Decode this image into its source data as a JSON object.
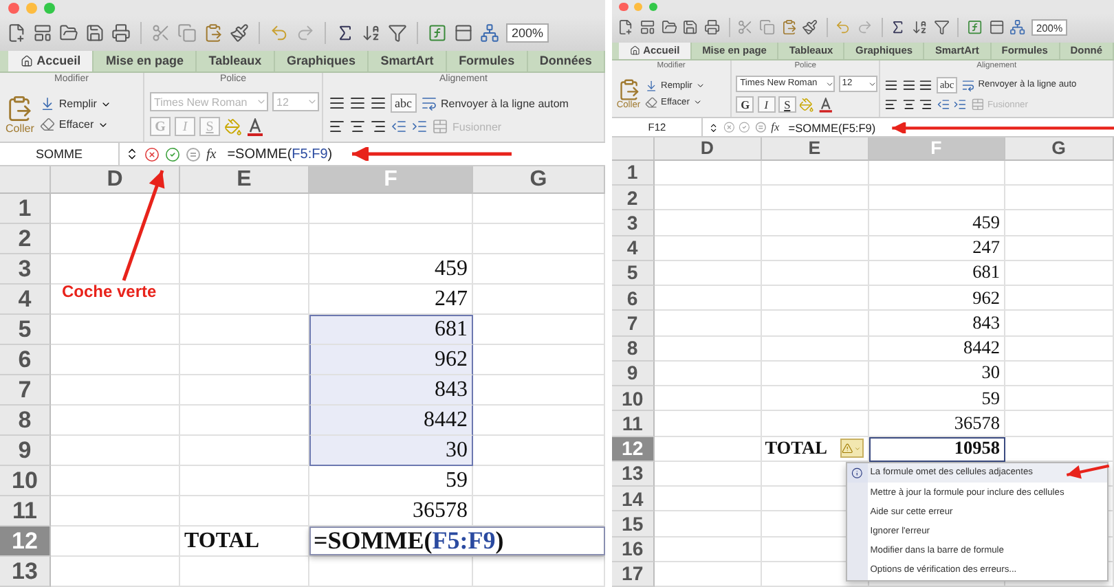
{
  "panels": [
    {
      "kind": "editing",
      "toolbar": {
        "zoom": "200%"
      },
      "tabs": [
        {
          "label": "Accueil",
          "selected": true
        },
        {
          "label": "Mise en page",
          "selected": false
        },
        {
          "label": "Tableaux",
          "selected": false
        },
        {
          "label": "Graphiques",
          "selected": false
        },
        {
          "label": "SmartArt",
          "selected": false
        },
        {
          "label": "Formules",
          "selected": false
        },
        {
          "label": "Données",
          "selected": false
        }
      ],
      "groups": [
        "Modifier",
        "Police",
        "Alignement"
      ],
      "edit": {
        "paste": "Coller",
        "fill": "Remplir",
        "clear": "Effacer"
      },
      "font": {
        "name": "Times New Roman",
        "size": "12",
        "disabled": true,
        "bold": "G",
        "italic": "I",
        "strike": "S"
      },
      "alignment": {
        "wrap_format": "abc",
        "wrap": "Renvoyer à la ligne autom",
        "merge": "Fusionner"
      },
      "formula_bar": {
        "name_box": "SOMME",
        "editing": true,
        "fx": "fx",
        "formula": [
          {
            "text": "=SOMME(",
            "ref": false
          },
          {
            "text": "F5:F9",
            "ref": true
          },
          {
            "text": ")",
            "ref": false
          }
        ]
      },
      "annotation": {
        "text": "Coche verte"
      },
      "sheet": {
        "columns": [
          {
            "label": "D",
            "selected": false
          },
          {
            "label": "E",
            "selected": false
          },
          {
            "label": "F",
            "selected": true
          },
          {
            "label": "G",
            "selected": false
          }
        ],
        "rows": [
          {
            "number": "1",
            "selected": false,
            "in_range": false
          },
          {
            "number": "2",
            "selected": false,
            "in_range": false
          },
          {
            "number": "3",
            "selected": false,
            "in_range": false,
            "value": "459"
          },
          {
            "number": "4",
            "selected": false,
            "in_range": false,
            "value": "247"
          },
          {
            "number": "5",
            "selected": false,
            "in_range": true,
            "value": "681"
          },
          {
            "number": "6",
            "selected": false,
            "in_range": true,
            "value": "962"
          },
          {
            "number": "7",
            "selected": false,
            "in_range": true,
            "value": "843"
          },
          {
            "number": "8",
            "selected": false,
            "in_range": true,
            "value": "8442"
          },
          {
            "number": "9",
            "selected": false,
            "in_range": true,
            "value": "30"
          },
          {
            "number": "10",
            "selected": false,
            "in_range": false,
            "value": "59"
          },
          {
            "number": "11",
            "selected": false,
            "in_range": false,
            "value": "36578"
          },
          {
            "number": "12",
            "selected": true,
            "in_range": false,
            "label": "TOTAL",
            "formula": [
              {
                "text": "=SOMME(",
                "ref": false
              },
              {
                "text": "F5:F9",
                "ref": true
              },
              {
                "text": ")",
                "ref": false
              }
            ]
          },
          {
            "number": "13",
            "selected": false,
            "in_range": false
          }
        ]
      }
    },
    {
      "kind": "error",
      "toolbar": {
        "zoom": "200%"
      },
      "tabs": [
        {
          "label": "Accueil",
          "selected": true
        },
        {
          "label": "Mise en page",
          "selected": false
        },
        {
          "label": "Tableaux",
          "selected": false
        },
        {
          "label": "Graphiques",
          "selected": false
        },
        {
          "label": "SmartArt",
          "selected": false
        },
        {
          "label": "Formules",
          "selected": false
        },
        {
          "label": "Donné",
          "selected": false
        }
      ],
      "groups": [
        "Modifier",
        "Police",
        "Alignement"
      ],
      "edit": {
        "paste": "Coller",
        "fill": "Remplir",
        "clear": "Effacer"
      },
      "font": {
        "name": "Times New Roman",
        "size": "12",
        "disabled": false,
        "bold": "G",
        "italic": "I",
        "strike": "S"
      },
      "alignment": {
        "wrap_format": "abc",
        "wrap": "Renvoyer à la ligne auto",
        "merge": "Fusionner"
      },
      "formula_bar": {
        "name_box": "F12",
        "editing": false,
        "fx": "fx",
        "formula": [
          {
            "text": "=SOMME(F5:F9)",
            "ref": false
          }
        ]
      },
      "sheet": {
        "columns": [
          {
            "label": "D",
            "selected": false
          },
          {
            "label": "E",
            "selected": false
          },
          {
            "label": "F",
            "selected": true
          },
          {
            "label": "G",
            "selected": false
          }
        ],
        "rows": [
          {
            "number": "1",
            "selected": false,
            "in_range": false
          },
          {
            "number": "2",
            "selected": false,
            "in_range": false
          },
          {
            "number": "3",
            "selected": false,
            "in_range": false,
            "value": "459"
          },
          {
            "number": "4",
            "selected": false,
            "in_range": false,
            "value": "247"
          },
          {
            "number": "5",
            "selected": false,
            "in_range": false,
            "value": "681"
          },
          {
            "number": "6",
            "selected": false,
            "in_range": false,
            "value": "962"
          },
          {
            "number": "7",
            "selected": false,
            "in_range": false,
            "value": "843"
          },
          {
            "number": "8",
            "selected": false,
            "in_range": false,
            "value": "8442"
          },
          {
            "number": "9",
            "selected": false,
            "in_range": false,
            "value": "30"
          },
          {
            "number": "10",
            "selected": false,
            "in_range": false,
            "value": "59"
          },
          {
            "number": "11",
            "selected": false,
            "in_range": false,
            "value": "36578"
          },
          {
            "number": "12",
            "selected": true,
            "in_range": false,
            "label": "TOTAL",
            "value": "10958"
          },
          {
            "number": "13",
            "selected": false,
            "in_range": false
          },
          {
            "number": "14",
            "selected": false,
            "in_range": false
          },
          {
            "number": "15",
            "selected": false,
            "in_range": false
          },
          {
            "number": "16",
            "selected": false,
            "in_range": false
          },
          {
            "number": "17",
            "selected": false,
            "in_range": false
          }
        ],
        "error_menu": {
          "items": [
            {
              "label": "La formule omet des cellules adjacentes",
              "selected": true
            },
            {
              "label": "Mettre à jour la formule pour inclure des cellules",
              "selected": false
            },
            {
              "label": "Aide sur cette erreur",
              "selected": false
            },
            {
              "label": "Ignorer l'erreur",
              "selected": false
            },
            {
              "label": "Modifier dans la barre de formule",
              "selected": false
            },
            {
              "label": "Options de vérification des erreurs...",
              "selected": false
            }
          ]
        }
      }
    }
  ]
}
